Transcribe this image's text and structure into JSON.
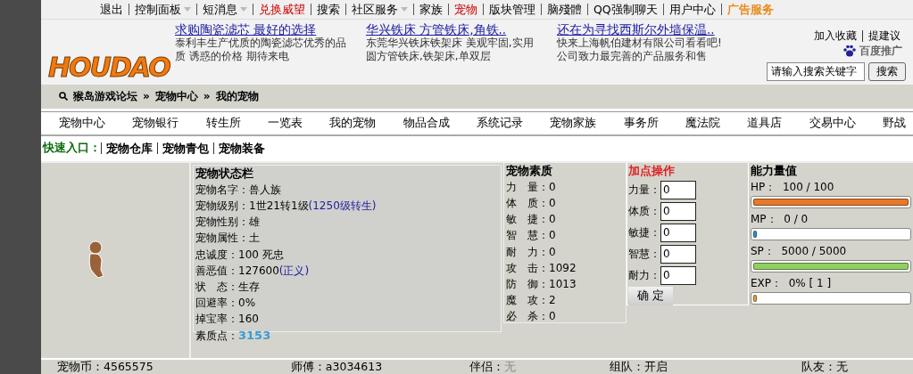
{
  "top_menu": [
    {
      "label": "退出",
      "kind": "plain",
      "dropdown": false
    },
    {
      "label": "控制面板",
      "kind": "plain",
      "dropdown": true
    },
    {
      "label": "短消息",
      "kind": "plain",
      "dropdown": true
    },
    {
      "label": "兑换威望",
      "kind": "alert",
      "dropdown": false
    },
    {
      "label": "搜索",
      "kind": "plain",
      "dropdown": false
    },
    {
      "label": "社区服务",
      "kind": "plain",
      "dropdown": true
    },
    {
      "label": "家族",
      "kind": "plain",
      "dropdown": false
    },
    {
      "label": "宠物",
      "kind": "alert",
      "dropdown": false
    },
    {
      "label": "版块管理",
      "kind": "plain",
      "dropdown": false
    },
    {
      "label": "脑殘體",
      "kind": "plain",
      "dropdown": false
    },
    {
      "label": "QQ强制聊天",
      "kind": "plain",
      "dropdown": false
    },
    {
      "label": "用户中心",
      "kind": "plain",
      "dropdown": false
    },
    {
      "label": "广告服务",
      "kind": "promo",
      "dropdown": false
    }
  ],
  "logo_text": "HOUDAO",
  "ads": [
    {
      "title": "求购陶瓷滤芯 最好的选择",
      "text": "泰利丰生产优质的陶瓷滤芯优秀的品质 诱惑的价格 期待来电"
    },
    {
      "title": "华兴铁床 方管铁床,角铁..",
      "text": "东莞华兴铁床铁架床 美观牢固,实用圆方管铁床,铁架床,单双层"
    },
    {
      "title": "还在为寻找西斯尔外墙保温..",
      "text": "快来上海帆伯建材有限公司看看吧!公司致力最完善的产品服务和售"
    }
  ],
  "ad_provider": "百度推广",
  "header_links": [
    "加入收藏",
    "提建议"
  ],
  "search": {
    "value": "请输入搜索关键字",
    "button": "搜索"
  },
  "breadcrumb": {
    "separator": "»",
    "items": [
      "猴岛游戏论坛",
      "宠物中心",
      "我的宠物"
    ]
  },
  "nav_tabs": [
    "宠物中心",
    "宠物银行",
    "转生所",
    "一览表",
    "我的宠物",
    "物品合成",
    "系统记录",
    "宠物家族",
    "事务所",
    "魔法院",
    "道具店",
    "交易中心",
    "野战"
  ],
  "quick_entry": {
    "label": "快速入口：",
    "items": [
      "宠物仓库",
      "宠物青包",
      "宠物装备"
    ]
  },
  "status": {
    "title": "宠物状态栏",
    "rows": [
      {
        "label": "宠物名字：",
        "value": "兽人族",
        "kind": "plain"
      },
      {
        "label": "宠物级别：",
        "value": "1世21转1级",
        "note": "(1250级转生)",
        "kind": "plain"
      },
      {
        "label": "宠物性别：",
        "value": "雄",
        "kind": "plain"
      },
      {
        "label": "宠物属性：",
        "value": "土",
        "kind": "plain"
      },
      {
        "label": "忠诚度：",
        "value": "100 死忠",
        "kind": "plain"
      },
      {
        "label": "善恶值：",
        "value": "127600",
        "note": "(正义)",
        "kind": "plain"
      },
      {
        "label": "状　态：",
        "value": "生存",
        "kind": "plain"
      },
      {
        "label": "回避率：",
        "value": "0%",
        "kind": "plain"
      },
      {
        "label": "掉宝率：",
        "value": "160",
        "kind": "plain"
      },
      {
        "label": "素质点：",
        "value": "3153",
        "kind": "highlight"
      }
    ]
  },
  "quality": {
    "title": "宠物素质",
    "rows": [
      {
        "label": "力　量：",
        "value": "0"
      },
      {
        "label": "体　质：",
        "value": "0"
      },
      {
        "label": "敏　捷：",
        "value": "0"
      },
      {
        "label": "智　慧：",
        "value": "0"
      },
      {
        "label": "耐　力：",
        "value": "0"
      },
      {
        "label": "攻　击：",
        "value": "1092"
      },
      {
        "label": "防　御：",
        "value": "1013"
      },
      {
        "label": "魔　攻：",
        "value": "2"
      },
      {
        "label": "必　杀：",
        "value": "0"
      }
    ]
  },
  "add_points": {
    "title": "加点操作",
    "fields": [
      {
        "label": "力量：",
        "value": "0"
      },
      {
        "label": "体质：",
        "value": "0"
      },
      {
        "label": "敏捷：",
        "value": "0"
      },
      {
        "label": "智慧：",
        "value": "0"
      },
      {
        "label": "耐力：",
        "value": "0"
      }
    ],
    "button": "确 定"
  },
  "abilities": {
    "title": "能力量值",
    "meters": [
      {
        "label": "HP：",
        "reading": "100 / 100",
        "level": 1,
        "color": "#e8782a"
      },
      {
        "label": "MP：",
        "reading": "0 / 0",
        "level": 0,
        "color": "#3a8fd0"
      },
      {
        "label": "SP：",
        "reading": "5000 / 5000",
        "level": 1,
        "color": "#8fd060"
      },
      {
        "label": "EXP：",
        "reading": "0% [ 1 ]",
        "level": 0,
        "color": "#e8a040"
      }
    ]
  },
  "footer": [
    {
      "label": "宠物币：",
      "value": "4565575",
      "muted": false
    },
    {
      "label": "师傅：",
      "value": "a3034613",
      "muted": false
    },
    {
      "label": "伴侣：",
      "value": "无",
      "muted": true
    },
    {
      "label": "组队：",
      "value": "开启",
      "muted": false
    },
    {
      "label": "队友：",
      "value": "无",
      "muted": false
    }
  ]
}
